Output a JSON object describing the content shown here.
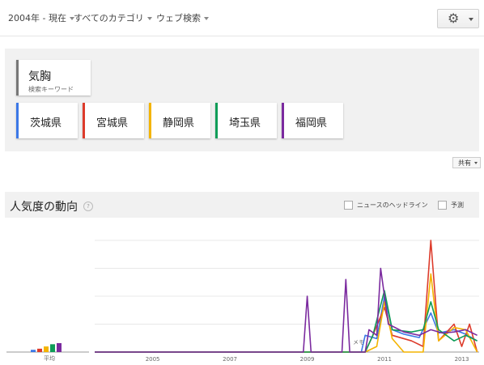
{
  "topbar": {
    "filters": [
      {
        "label": "2004年 - 現在"
      },
      {
        "label": "すべてのカテゴリ"
      },
      {
        "label": "ウェブ検索"
      }
    ],
    "settings_icon": "gear-icon"
  },
  "keyword": {
    "term": "気胸",
    "sublabel": "検索キーワード"
  },
  "regions": [
    {
      "label": "茨城県",
      "color": "#3b78e7"
    },
    {
      "label": "宮城県",
      "color": "#dd3b2b"
    },
    {
      "label": "静岡県",
      "color": "#f4b400"
    },
    {
      "label": "埼玉県",
      "color": "#0f9d58"
    },
    {
      "label": "福岡県",
      "color": "#7b2a9f"
    }
  ],
  "share_label": "共有",
  "trend": {
    "title": "人気度の動向",
    "help": "?",
    "news_label": "ニュースのヘッドライン",
    "forecast_label": "予測",
    "average_label": "平均",
    "note_label": "メモ"
  },
  "chart_data": {
    "type": "line",
    "x_ticks": [
      "2005",
      "2007",
      "2009",
      "2011",
      "2013"
    ],
    "ylim": [
      0,
      100
    ],
    "averages": [
      2,
      3,
      5,
      7,
      8
    ],
    "series": [
      {
        "name": "茨城県",
        "color": "#3b78e7",
        "points": [
          [
            2004.0,
            0
          ],
          [
            2010.9,
            0
          ],
          [
            2011.0,
            15
          ],
          [
            2011.3,
            12
          ],
          [
            2011.5,
            50
          ],
          [
            2011.7,
            20
          ],
          [
            2012.0,
            16
          ],
          [
            2012.4,
            13
          ],
          [
            2012.7,
            35
          ],
          [
            2012.9,
            17
          ],
          [
            2013.3,
            20
          ],
          [
            2013.6,
            16
          ],
          [
            2013.9,
            10
          ]
        ]
      },
      {
        "name": "宮城県",
        "color": "#dd3b2b",
        "points": [
          [
            2004.0,
            0
          ],
          [
            2011.0,
            0
          ],
          [
            2011.2,
            15
          ],
          [
            2011.5,
            40
          ],
          [
            2011.7,
            15
          ],
          [
            2012.2,
            10
          ],
          [
            2012.5,
            5
          ],
          [
            2012.7,
            100
          ],
          [
            2012.9,
            10
          ],
          [
            2013.3,
            25
          ],
          [
            2013.5,
            5
          ],
          [
            2013.7,
            25
          ],
          [
            2013.9,
            0
          ]
        ]
      },
      {
        "name": "静岡県",
        "color": "#f4b400",
        "points": [
          [
            2004.0,
            0
          ],
          [
            2011.0,
            0
          ],
          [
            2011.3,
            5
          ],
          [
            2011.5,
            45
          ],
          [
            2011.7,
            12
          ],
          [
            2012.0,
            0
          ],
          [
            2012.5,
            0
          ],
          [
            2012.7,
            70
          ],
          [
            2012.9,
            10
          ],
          [
            2013.3,
            22
          ],
          [
            2013.6,
            20
          ],
          [
            2013.9,
            0
          ]
        ]
      },
      {
        "name": "埼玉県",
        "color": "#0f9d58",
        "points": [
          [
            2004.0,
            0
          ],
          [
            2011.0,
            0
          ],
          [
            2011.2,
            15
          ],
          [
            2011.5,
            55
          ],
          [
            2011.7,
            20
          ],
          [
            2012.2,
            18
          ],
          [
            2012.5,
            20
          ],
          [
            2012.7,
            45
          ],
          [
            2012.9,
            20
          ],
          [
            2013.3,
            10
          ],
          [
            2013.6,
            15
          ],
          [
            2013.9,
            10
          ]
        ]
      },
      {
        "name": "福岡県",
        "color": "#7b2a9f",
        "points": [
          [
            2004.0,
            0
          ],
          [
            2009.4,
            0
          ],
          [
            2009.5,
            50
          ],
          [
            2009.6,
            0
          ],
          [
            2010.4,
            0
          ],
          [
            2010.5,
            65
          ],
          [
            2010.6,
            0
          ],
          [
            2011.0,
            0
          ],
          [
            2011.1,
            20
          ],
          [
            2011.3,
            15
          ],
          [
            2011.4,
            75
          ],
          [
            2011.6,
            25
          ],
          [
            2012.0,
            18
          ],
          [
            2012.4,
            15
          ],
          [
            2012.7,
            20
          ],
          [
            2013.0,
            17
          ],
          [
            2013.3,
            18
          ],
          [
            2013.6,
            20
          ],
          [
            2013.9,
            15
          ]
        ]
      }
    ]
  }
}
